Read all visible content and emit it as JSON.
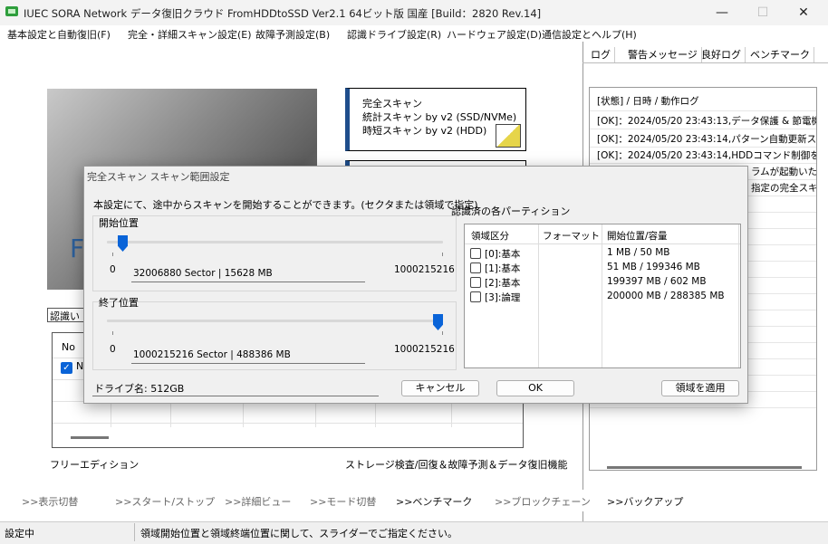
{
  "window": {
    "title": "IUEC SORA Network データ復旧クラウド FromHDDtoSSD Ver2.1 64ビット版 国産 [Build：2820 Rev.14]",
    "minimize": "—",
    "maximize": "☐",
    "close": "✕"
  },
  "menu": [
    "基本設定と自動復旧(F)",
    "完全・詳細スキャン設定(E)",
    "故障予測設定(B)",
    "認識ドライブ設定(R)",
    "ハードウェア設定(D)",
    "通信設定とヘルプ(H)"
  ],
  "main": {
    "image_letter": "F",
    "scan_button_1": [
      "完全スキャン",
      "統計スキャン by v2 (SSD/NVMe)",
      "時短スキャン by v2 (HDD)"
    ],
    "recognize_label": "認識い",
    "drive_table_header": "No",
    "drive_row_text": "N",
    "free_edition": "フリーエディション",
    "features": "ストレージ検査/回復＆故障予測＆データ復旧機能"
  },
  "right_panel": {
    "tabs": [
      "ログ",
      "警告メッセージ",
      "良好ログ",
      "ベンチマーク"
    ],
    "log_header": "[状態] / 日時 / 動作ログ",
    "log_lines": [
      "[OK]：2024/05/20 23:43:13,データ保護 & 節電機",
      "[OK]：2024/05/20 23:43:14,パターン自動更新スレ",
      "[OK]：2024/05/20 23:43:14,HDDコマンド制御を購",
      "ラムが起動いた",
      "指定の完全スキ"
    ]
  },
  "bottom_nav": [
    {
      "label": ">>表示切替",
      "active": false
    },
    {
      "label": ">>スタート/ストップ",
      "active": false
    },
    {
      "label": ">>詳細ビュー",
      "active": false
    },
    {
      "label": ">>モード切替",
      "active": false
    },
    {
      "label": ">>ベンチマーク",
      "active": true
    },
    {
      "label": ">>ブロックチェーン",
      "active": false
    },
    {
      "label": ">>バックアップ",
      "active": true
    }
  ],
  "status": {
    "left": "設定中",
    "message": "領域開始位置と領域終端位置に関して、スライダーでご指定ください。"
  },
  "dialog": {
    "title": "完全スキャン スキャン範囲設定",
    "description": "本設定にて、途中からスキャンを開始することができます。(セクタまたは領域で指定)",
    "start": {
      "label": "開始位置",
      "min": "0",
      "max": "1000215216",
      "value": "32006880 Sector | 15628 MB",
      "fraction": 0.032
    },
    "end": {
      "label": "終了位置",
      "min": "0",
      "max": "1000215216",
      "value": "1000215216 Sector | 488386 MB",
      "fraction": 1.0
    },
    "partition_label": "認識済の各パーティション",
    "partition_table": {
      "headers": [
        "領域区分",
        "フォーマット",
        "開始位置/容量"
      ],
      "rows": [
        {
          "type": "[0]:基本",
          "format": "",
          "size": "1 MB / 50 MB"
        },
        {
          "type": "[1]:基本",
          "format": "",
          "size": "51 MB / 199346 MB"
        },
        {
          "type": "[2]:基本",
          "format": "",
          "size": "199397 MB / 602 MB"
        },
        {
          "type": "[3]:論理",
          "format": "",
          "size": "200000 MB / 288385 MB"
        }
      ]
    },
    "drive_name": "ドライブ名: 512GB",
    "cancel_label": "キャンセル",
    "ok_label": "OK",
    "apply_label": "領域を適用"
  },
  "colors": {
    "accent": "#0a64d8",
    "scan_border": "#1f4e8c",
    "app_icon": "#2e9e3c"
  }
}
